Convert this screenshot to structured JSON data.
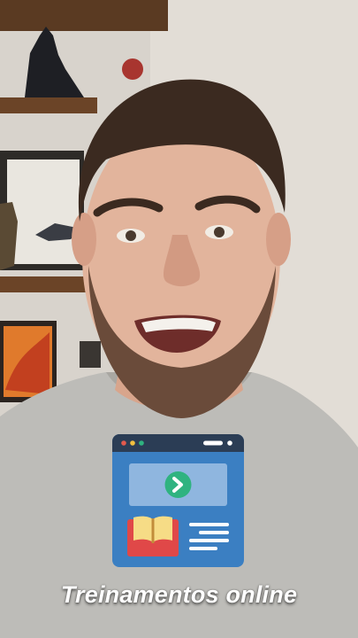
{
  "caption": {
    "text": "Treinamentos online"
  },
  "sticker": {
    "icon": "online-course-window-icon",
    "colors": {
      "window": "#3b7fc2",
      "titlebar": "#2b3d55",
      "screen": "#8fb6df",
      "play_circle": "#2fb380",
      "book_base": "#e04848",
      "book_pages": "#f6dc86",
      "text_lines": "#ffffff"
    }
  }
}
